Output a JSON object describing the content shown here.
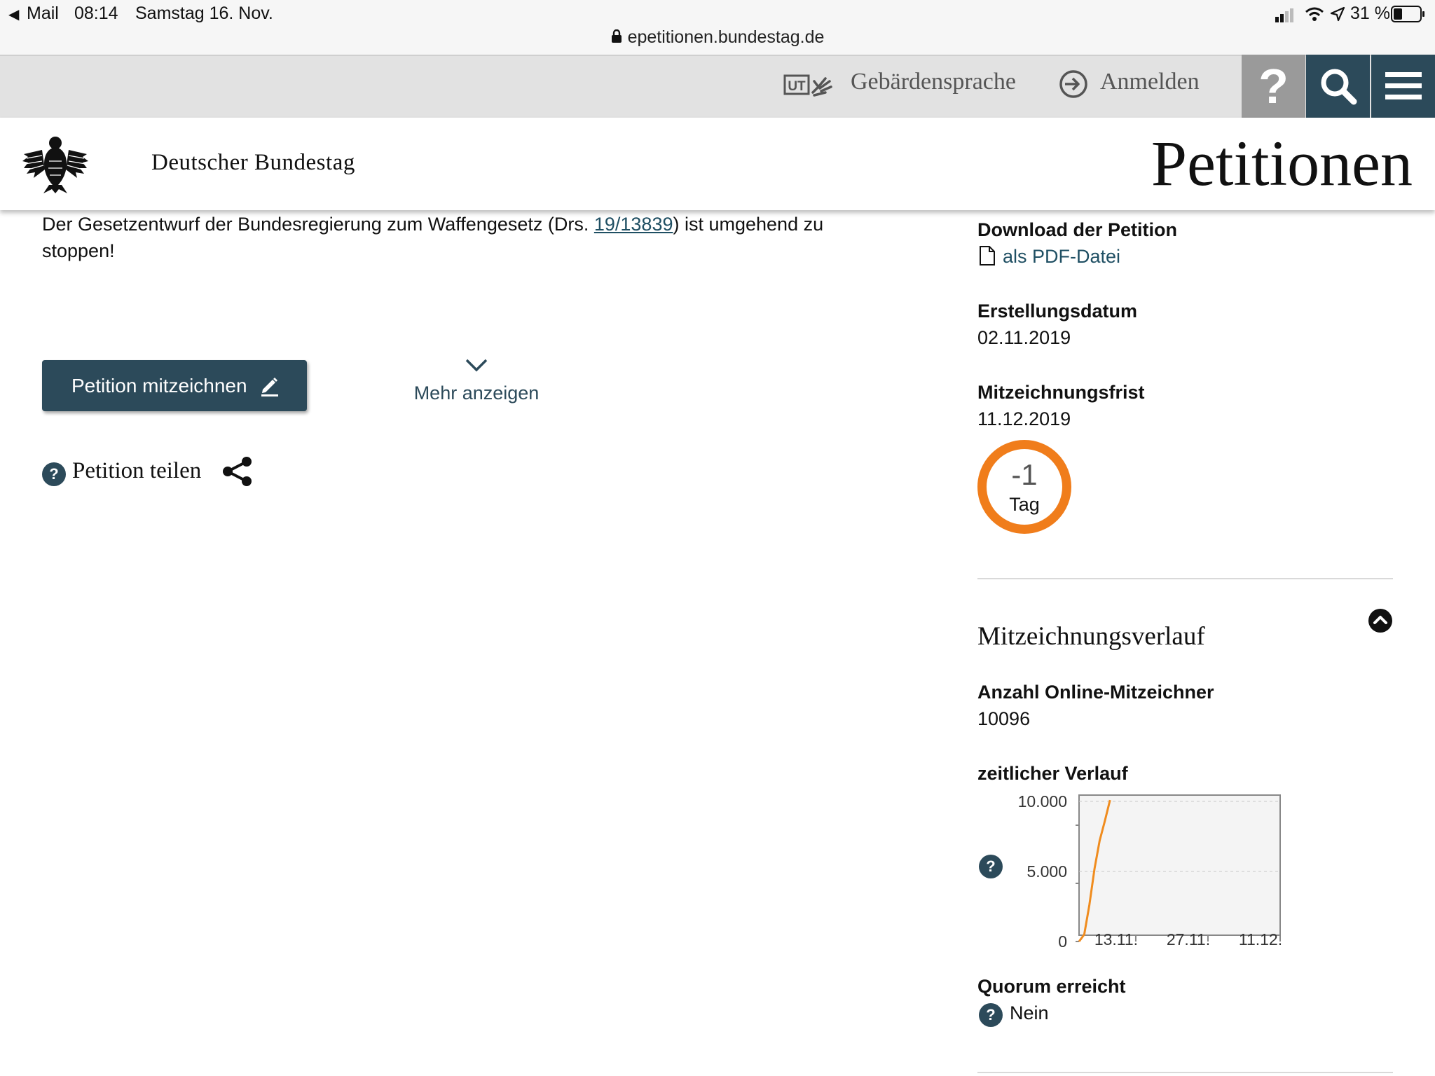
{
  "statusbar": {
    "back_app": "Mail",
    "time": "08:14",
    "date": "Samstag 16. Nov.",
    "battery": "31 %",
    "url": "epetitionen.bundestag.de"
  },
  "toolbar": {
    "sign_language_label": "Gebärdensprache",
    "login_label": "Anmelden",
    "help_glyph": "?",
    "colors": {
      "help_bg": "#9a9a9a",
      "nav_bg": "#2c4a5a"
    }
  },
  "header": {
    "org_name": "Deutscher Bundestag",
    "site_title": "Petitionen"
  },
  "main": {
    "text_before_link": "Der Gesetzentwurf der Bundesregierung zum Waffengesetz (Drs. ",
    "link_text": "19/13839",
    "text_after_link": ") ist umgehend zu",
    "text_line2": "stoppen!",
    "sign_button_label": "Petition mitzeichnen",
    "more_label": "Mehr anzeigen",
    "share_label": "Petition teilen"
  },
  "sidebar": {
    "download_label": "Download der Petition",
    "pdf_link": "als PDF-Datei",
    "created_label": "Erstellungsdatum",
    "created_value": "02.11.2019",
    "deadline_label": "Mitzeichnungsfrist",
    "deadline_value": "11.12.2019",
    "countdown_value": "-1",
    "countdown_unit": "Tag",
    "history_title": "Mitzeichnungsverlauf",
    "online_count_label": "Anzahl Online-Mitzeichner",
    "online_count_value": "10096",
    "timeline_label": "zeitlicher Verlauf",
    "quorum_label": "Quorum erreicht",
    "quorum_value": "Nein"
  },
  "chart_data": {
    "type": "line",
    "x": [
      "02.11.",
      "03.11.",
      "04.11.",
      "05.11.",
      "06.11.",
      "07.11.",
      "08.11."
    ],
    "series": [
      {
        "values": [
          0,
          500,
          2600,
          5200,
          7200,
          8600,
          10096
        ]
      }
    ],
    "x_ticks": [
      "13.11.",
      "27.11.",
      "11.12."
    ],
    "y_ticks": [
      "10.000",
      "5.000",
      "0"
    ],
    "ylim": [
      0,
      10000
    ],
    "xlim": [
      "02.11.",
      "11.12."
    ],
    "grid": true,
    "line_color": "#f08c1e"
  }
}
